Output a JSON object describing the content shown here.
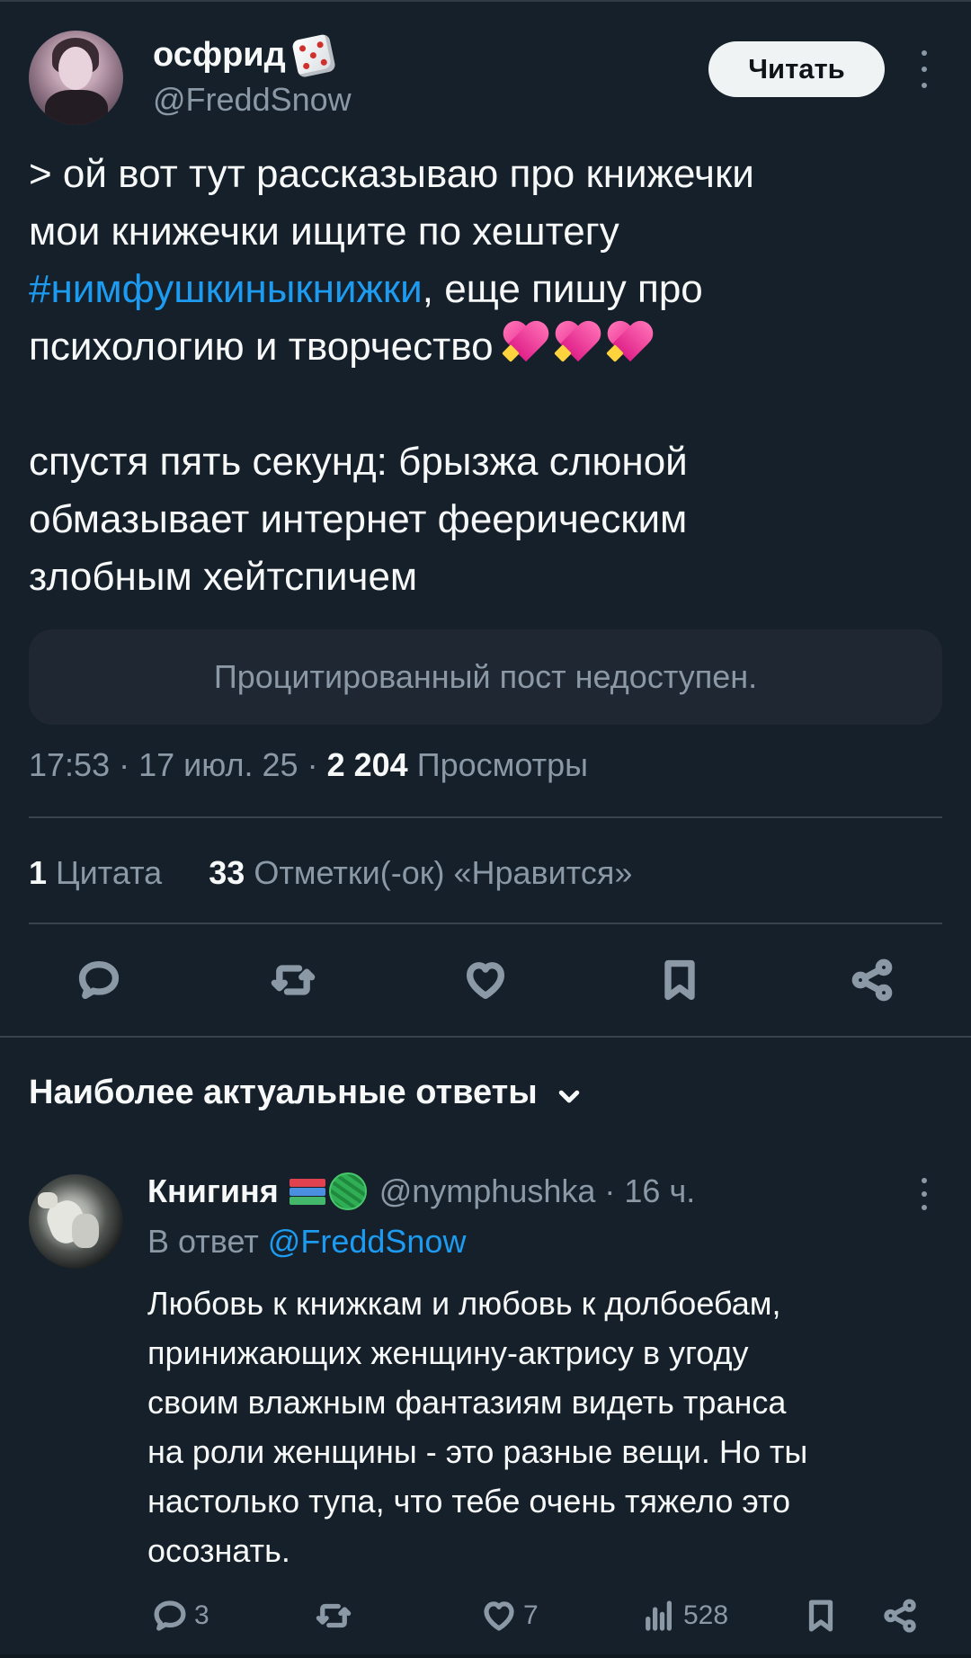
{
  "post": {
    "author_name": "осфрид",
    "author_emoji": "game-die-emoji",
    "author_handle": "@FreddSnow",
    "follow_label": "Читать",
    "text_lines": [
      "> ой вот тут рассказываю про книжечки",
      "мои книжечки ищите по хештегу"
    ],
    "hashtag": "#нимфушкиныкнижки",
    "after_hashtag": ", еще пишу про",
    "line4": "психологию и творчество",
    "hearts_emoji": "sparkling-heart-emoji x3",
    "para2_lines": [
      "спустя пять секунд: брызжа слюной",
      "обмазывает интернет феерическим",
      "злобным хейтспичем"
    ],
    "quoted_unavailable": "Процитированный пост недоступен.",
    "time": "17:53",
    "date": "17 июл. 25",
    "dot": "·",
    "views_count": "2 204",
    "views_label": "Просмотры"
  },
  "stats": {
    "quotes_count": "1",
    "quotes_label": "Цитата",
    "likes_count": "33",
    "likes_label": "Отметки(-ок) «Нравится»"
  },
  "actions": [
    "reply-icon",
    "retweet-icon",
    "like-icon",
    "bookmark-icon",
    "share-icon"
  ],
  "replies_header": "Наиболее актуальные ответы",
  "reply": {
    "name": "Книгиня",
    "emojis": [
      "books-emoji",
      "yarn-emoji"
    ],
    "handle": "@nymphushka",
    "dot": "·",
    "time": "16 ч.",
    "reply_to_label": "В ответ",
    "reply_to_handle": "@FreddSnow",
    "text_lines": [
      "Любовь к книжкам и любовь к долбоебам,",
      "принижающих женщину-актрису в угоду",
      "своим влажным фантазиям видеть транса",
      "на роли женщины - это разные вещи. Но ты",
      "настолько тупа, что тебе очень тяжело это",
      "осознать."
    ],
    "replies_count": "3",
    "likes_count": "7",
    "views_count": "528"
  },
  "colors": {
    "background": "#15202b",
    "accent": "#1d9bf0",
    "muted": "#8b98a5",
    "text": "#f7f9f9"
  }
}
